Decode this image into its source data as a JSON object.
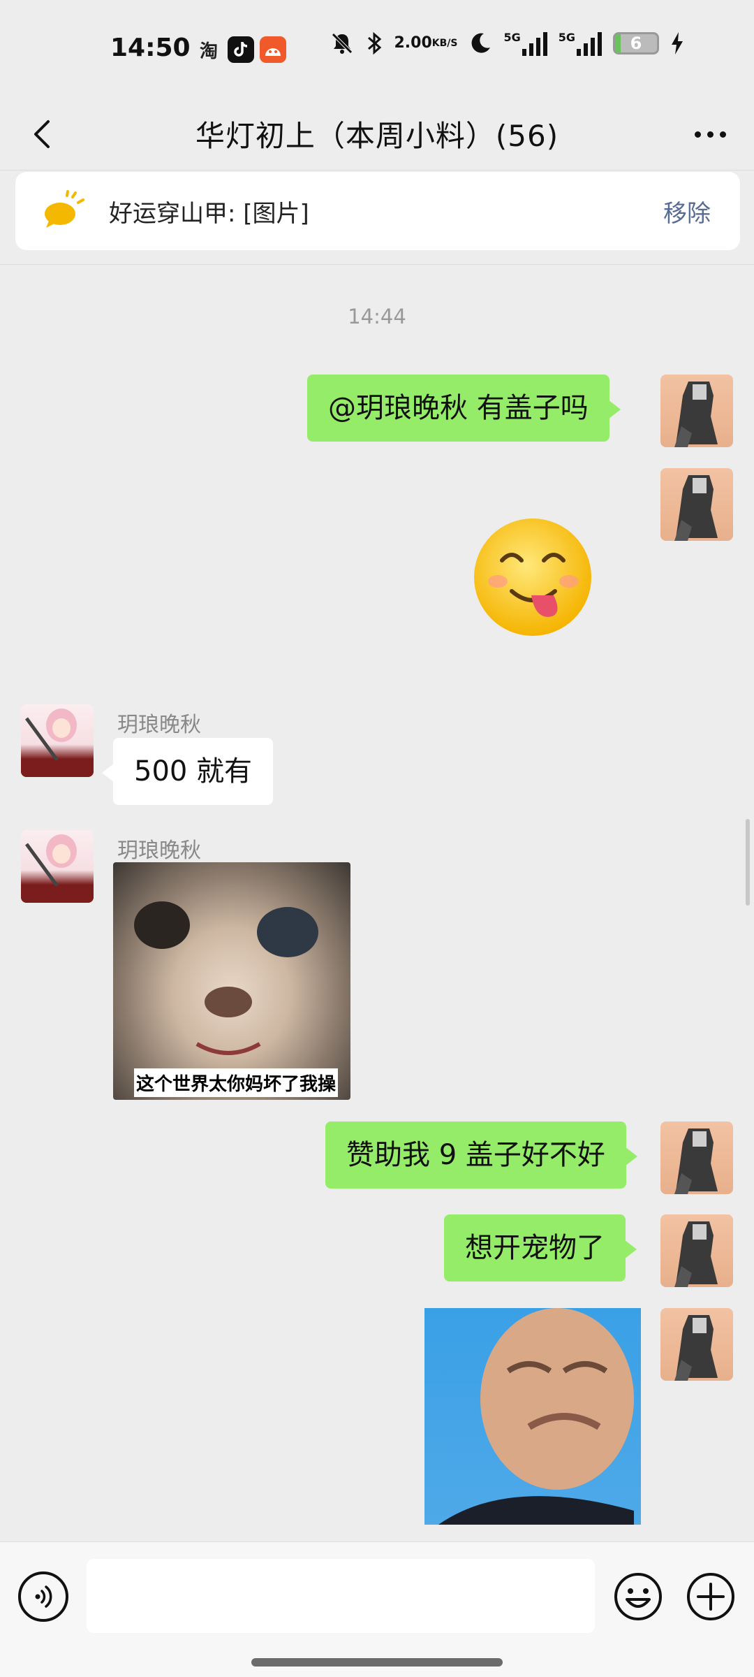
{
  "status_bar": {
    "time": "14:50",
    "apps": [
      "淘",
      "tiktok-icon",
      "orange-app-icon"
    ],
    "net_speed_value": "2.00",
    "net_speed_unit": "KB/S",
    "net_type_1": "5G",
    "net_type_2": "5G",
    "battery_level": "6"
  },
  "header": {
    "title": "华灯初上（本周小料）(56)"
  },
  "pinned": {
    "text": "好运穿山甲: [图片]",
    "remove_label": "移除"
  },
  "chat": {
    "timestamp": "14:44",
    "messages": [
      {
        "from": "me",
        "type": "text",
        "text": "@玥琅晚秋  有盖子吗"
      },
      {
        "from": "me",
        "type": "sticker",
        "sticker": "yum-emoji"
      },
      {
        "from": "other",
        "sender": "玥琅晚秋",
        "type": "text",
        "text": "500 就有"
      },
      {
        "from": "other",
        "sender": "玥琅晚秋",
        "type": "sticker",
        "caption": "这个世界太你妈坏了我操"
      },
      {
        "from": "me",
        "type": "text",
        "text": "赞助我 9 盖子好不好"
      },
      {
        "from": "me",
        "type": "text",
        "text": "想开宠物了"
      },
      {
        "from": "me",
        "type": "sticker",
        "sticker": "crying-face-meme"
      }
    ]
  },
  "input": {
    "placeholder": ""
  },
  "colors": {
    "bubble_me": "#95ec69",
    "bubble_other": "#ffffff",
    "background": "#ededed",
    "link": "#576b95"
  }
}
